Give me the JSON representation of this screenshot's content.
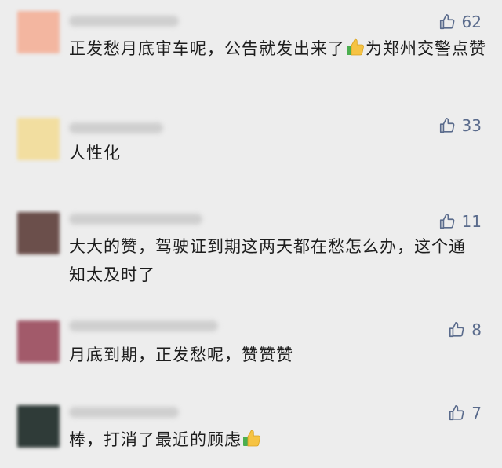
{
  "comments": [
    {
      "likes": "62",
      "text_a": "正发愁月底审车呢，公告就发出来了",
      "text_b": "为郑州交警点赞",
      "avatar_color": "#f3b6a0"
    },
    {
      "likes": "33",
      "text_a": "人性化",
      "avatar_color": "#f2dea0"
    },
    {
      "likes": "11",
      "text_a": "大大的赞，驾驶证到期这两天都在愁怎么办，这个通知太及时了",
      "avatar_color": "#6b4f4b"
    },
    {
      "likes": "8",
      "text_a": "月底到期，正发愁呢，赞赞赞",
      "avatar_color": "#a25a6a"
    },
    {
      "likes": "7",
      "text_a": "棒，打消了最近的顾虑",
      "avatar_color": "#2f3b38"
    }
  ],
  "icons": {
    "like": "thumbs-up-outline-icon",
    "emoji": "thumbs-up-emoji-icon"
  },
  "colors": {
    "background": "#ededed",
    "like_count": "#5a6b8c",
    "emoji_yellow": "#f6c343",
    "emoji_cuff": "#4caf50"
  }
}
